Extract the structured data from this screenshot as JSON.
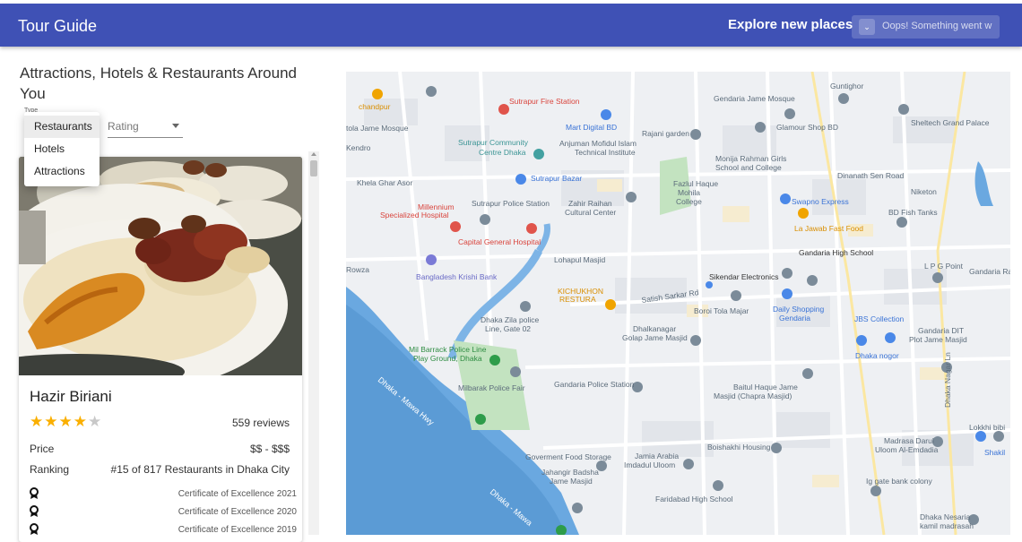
{
  "app": {
    "title": "Tour Guide",
    "explore_label": "Explore new places",
    "search_text": "Oops! Something went w",
    "search_icon": "search-icon"
  },
  "panel": {
    "heading": "Attractions, Hotels & Restaurants Around You",
    "type_label": "Type",
    "type_options": [
      "Restaurants",
      "Hotels",
      "Attractions"
    ],
    "type_selected": "Restaurants",
    "rating_placeholder": "Rating"
  },
  "place": {
    "name": "Hazir Biriani",
    "rating": 4,
    "rating_max": 5,
    "reviews": "559 reviews",
    "price_label": "Price",
    "price": "$$ - $$$",
    "ranking_label": "Ranking",
    "ranking": "#15 of 817 Restaurants in Dhaka City",
    "awards": [
      "Certificate of Excellence 2021",
      "Certificate of Excellence 2020",
      "Certificate of Excellence 2019"
    ]
  },
  "map": {
    "labels": [
      "Sutrapur Fire Station",
      "Gendaria Jame Mosque",
      "Guntighor",
      "Mart Digital BD",
      "Rajani garden",
      "Glamour Shop BD",
      "Sheltech Grand Palace",
      "Sutrapur Community Centre Dhaka",
      "Anjuman Mofidul Islam Technical Institute",
      "Monija Rahman Girls School and College",
      "Sutrapur Bazar",
      "Fazlul Haque Mohila College",
      "Dinanath Sen Road",
      "Niketon",
      "Millennium Specialized Hospital",
      "Sutrapur Police Station",
      "Zahir Raihan Cultural Center",
      "Swapno Express",
      "BD Fish Tanks",
      "Capital General Hospital",
      "La Jawab Fast Food",
      "Gandaria High School",
      "Lohapul Masjid",
      "L P G Point",
      "Gandaria Ra",
      "Bangladesh Krishi Bank",
      "Sikendar Electronics",
      "KICHUKHON RESTURA",
      "Satish Sarkar Rd",
      "Boroi Tola Majar",
      "Daily Shopping Gendaria",
      "JBS Collection",
      "Dhaka Zila police Line, Gate 02",
      "Dhalkanagar Golap Jame Masjid",
      "Gandaria DIT Plot Jame Masjid",
      "Mil Barrack Police Line Play Ground, Dhaka",
      "Dhaka nogor",
      "Milbarak Police Fair",
      "Gandaria Police Station",
      "Baitul Haque Jame Masjid (Chapra Masjid)",
      "Lokkhi bibi",
      "Boishakhi Housing",
      "Madrasa Darul Uloom Al-Emdadia",
      "Shakil",
      "Goverment Food Storage",
      "Jamia Arabia Imdadul Uloom",
      "Jahangir Badsha Jame Masjid",
      "Ig gate bank colony",
      "Faridabad High School",
      "Dhaka Nesaria kamil madrasah",
      "chandpur",
      "tola Jame Mosque",
      "Kendro",
      "Khela Ghar Asor",
      "Rowza",
      "Dhaka Nagar Ln",
      "Dhaka - Mawa Hwy",
      "Dhaka - Mawa"
    ]
  },
  "colors": {
    "appbar": "#3f51b5",
    "star": "#faaf00",
    "river": "#5b9bd5"
  }
}
